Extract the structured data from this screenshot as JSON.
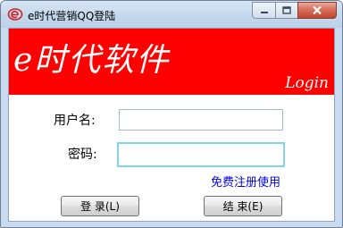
{
  "window": {
    "title": "e时代营销QQ登陆",
    "icons": {
      "app": "e-logo-icon",
      "minimize": "minimize-icon",
      "maximize": "maximize-icon",
      "close": "close-icon"
    }
  },
  "banner": {
    "title": "e时代软件",
    "subtitle": "Login",
    "background_color": "#ff0000"
  },
  "form": {
    "username_label": "用户名:",
    "username_value": "",
    "password_label": "密码:",
    "password_value": "",
    "register_link": "免费注册使用"
  },
  "buttons": {
    "login_label": "登  录(L)",
    "end_label": "结  束(E)"
  }
}
